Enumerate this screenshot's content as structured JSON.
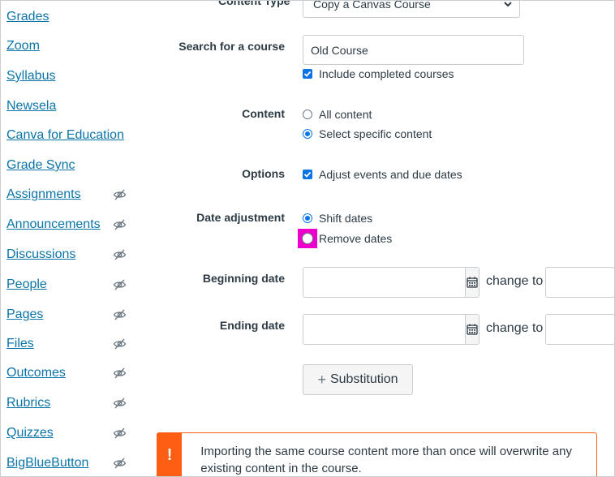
{
  "sidebar": {
    "items": [
      {
        "label": "Grades",
        "hidden": false
      },
      {
        "label": "Zoom",
        "hidden": false
      },
      {
        "label": "Syllabus",
        "hidden": false
      },
      {
        "label": "Newsela",
        "hidden": false
      },
      {
        "label": "Canva for Education",
        "hidden": false
      },
      {
        "label": "Grade Sync",
        "hidden": false
      },
      {
        "label": "Assignments",
        "hidden": true
      },
      {
        "label": "Announcements",
        "hidden": true
      },
      {
        "label": "Discussions",
        "hidden": true
      },
      {
        "label": "People",
        "hidden": true
      },
      {
        "label": "Pages",
        "hidden": true
      },
      {
        "label": "Files",
        "hidden": true
      },
      {
        "label": "Outcomes",
        "hidden": true
      },
      {
        "label": "Rubrics",
        "hidden": true
      },
      {
        "label": "Quizzes",
        "hidden": true
      },
      {
        "label": "BigBlueButton",
        "hidden": true
      }
    ],
    "hidden_icon": "eye-slash-icon"
  },
  "form": {
    "content_type": {
      "label": "Content Type",
      "value": "Copy a Canvas Course"
    },
    "search": {
      "label": "Search for a course",
      "value": "Old Course",
      "include_completed_label": "Include completed courses",
      "include_completed_checked": true
    },
    "content": {
      "label": "Content",
      "all_label": "All content",
      "specific_label": "Select specific content",
      "selected": "specific"
    },
    "options": {
      "label": "Options",
      "adjust_label": "Adjust events and due dates",
      "adjust_checked": true
    },
    "date_adjustment": {
      "label": "Date adjustment",
      "shift_label": "Shift dates",
      "remove_label": "Remove dates",
      "selected": "shift"
    },
    "beginning_date": {
      "label": "Beginning date",
      "value": "",
      "change_to_label": "change to"
    },
    "ending_date": {
      "label": "Ending date",
      "value": "",
      "change_to_label": "change to"
    },
    "substitution_button": "Substitution"
  },
  "alert": {
    "icon": "!",
    "text": "Importing the same course content more than once will overwrite any existing content in the course."
  },
  "colors": {
    "link": "#0b74a8",
    "accent": "#0b74e5",
    "warning": "#fc5e13",
    "highlight": "#ee00cc"
  }
}
